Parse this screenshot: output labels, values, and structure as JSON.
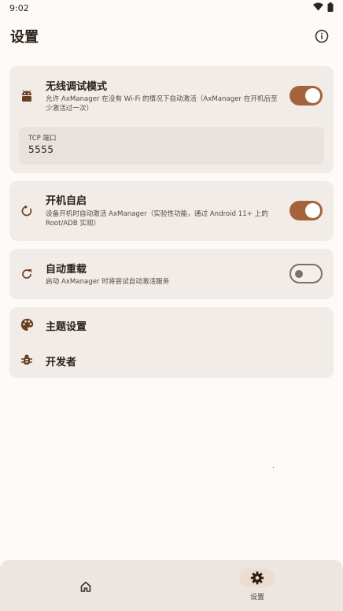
{
  "status_bar": {
    "time": "9:02"
  },
  "app_bar": {
    "title": "设置"
  },
  "wireless_debug": {
    "title": "无线调试模式",
    "description": "允许 AxManager 在没有 Wi-Fi 的情况下自动激活（AxManager 在开机后至少激活过一次）",
    "enabled": true,
    "port_label": "TCP 端口",
    "port_value": "5555"
  },
  "boot_start": {
    "title": "开机自启",
    "description": "设备开机时自动激活 AxManager（实验性功能，通过 Android 11+ 上的 Root/ADB 实现）",
    "enabled": true
  },
  "auto_reload": {
    "title": "自动重载",
    "description": "启动 AxManager 时将尝试自动激活服务",
    "enabled": false
  },
  "theme_settings": {
    "title": "主题设置"
  },
  "developer": {
    "title": "开发者"
  },
  "bottom_nav": {
    "items": [
      {
        "label": "",
        "icon": "home-icon",
        "active": false
      },
      {
        "label": "设置",
        "icon": "gear-icon",
        "active": true
      }
    ]
  },
  "colors": {
    "accent": "#a5633b",
    "background": "#fdfaf8",
    "card": "#f1ece8",
    "icon_brown": "#6b3f22"
  }
}
